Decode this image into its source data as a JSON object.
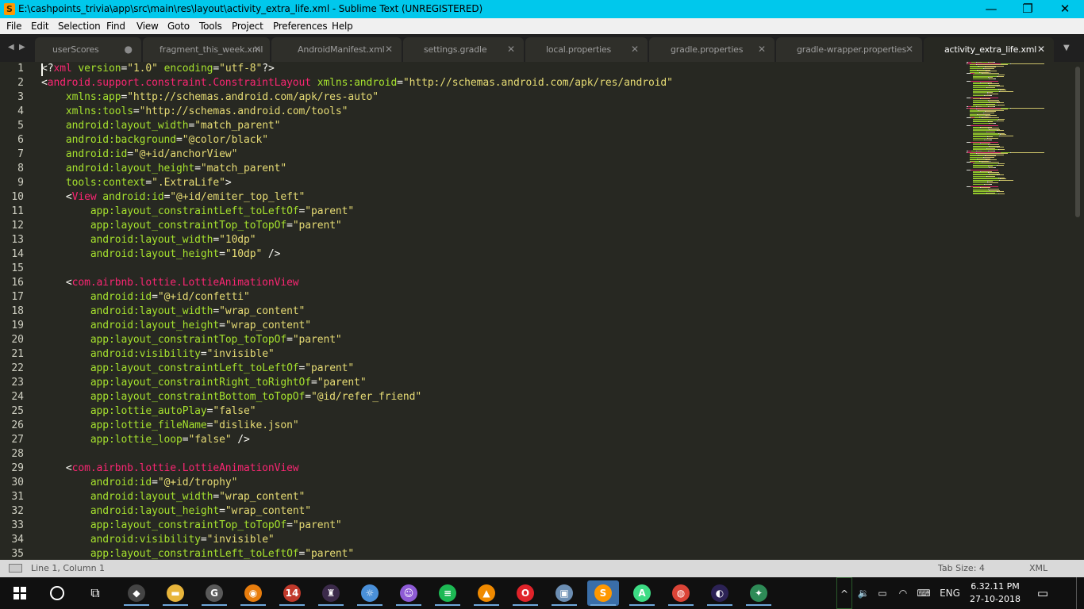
{
  "window": {
    "title": "E:\\cashpoints_trivia\\app\\src\\main\\res\\layout\\activity_extra_life.xml - Sublime Text (UNREGISTERED)",
    "app_icon_letter": "S",
    "controls": {
      "minimize": "—",
      "maximize": "❐",
      "close": "✕"
    },
    "title_bar_color": "#00c8ec"
  },
  "menu": [
    "File",
    "Edit",
    "Selection",
    "Find",
    "View",
    "Goto",
    "Tools",
    "Project",
    "Preferences",
    "Help"
  ],
  "tabs": [
    {
      "label": "userScores",
      "close": "●",
      "active": false
    },
    {
      "label": "fragment_this_week.xml",
      "close": "✕",
      "active": false
    },
    {
      "label": "AndroidManifest.xml",
      "close": "✕",
      "active": false
    },
    {
      "label": "settings.gradle",
      "close": "✕",
      "active": false
    },
    {
      "label": "local.properties",
      "close": "✕",
      "active": false
    },
    {
      "label": "gradle.properties",
      "close": "✕",
      "active": false
    },
    {
      "label": "gradle-wrapper.properties",
      "close": "✕",
      "active": false
    },
    {
      "label": "activity_extra_life.xml",
      "close": "✕",
      "active": true
    }
  ],
  "tab_nav": {
    "left": "◀",
    "right": "▶",
    "menu": "▼"
  },
  "colors": {
    "editor_bg": "#272822",
    "tag": "#f92672",
    "attribute": "#a6e22e",
    "string": "#e6db74",
    "plain": "#f8f8f2"
  },
  "code_lines": [
    [
      [
        "p",
        "<?"
      ],
      [
        "t",
        "xml "
      ],
      [
        "a",
        "version"
      ],
      [
        "p",
        "="
      ],
      [
        "s",
        "\"1.0\" "
      ],
      [
        "a",
        "encoding"
      ],
      [
        "p",
        "="
      ],
      [
        "s",
        "\"utf-8\""
      ],
      [
        "p",
        "?>"
      ]
    ],
    [
      [
        "p",
        "<"
      ],
      [
        "t",
        "android.support.constraint.ConstraintLayout "
      ],
      [
        "a",
        "xmlns:android"
      ],
      [
        "p",
        "="
      ],
      [
        "s",
        "\"http://schemas.android.com/apk/res/android\""
      ]
    ],
    [
      [
        "p",
        "    "
      ],
      [
        "a",
        "xmlns:app"
      ],
      [
        "p",
        "="
      ],
      [
        "s",
        "\"http://schemas.android.com/apk/res-auto\""
      ]
    ],
    [
      [
        "p",
        "    "
      ],
      [
        "a",
        "xmlns:tools"
      ],
      [
        "p",
        "="
      ],
      [
        "s",
        "\"http://schemas.android.com/tools\""
      ]
    ],
    [
      [
        "p",
        "    "
      ],
      [
        "a",
        "android:layout_width"
      ],
      [
        "p",
        "="
      ],
      [
        "s",
        "\"match_parent\""
      ]
    ],
    [
      [
        "p",
        "    "
      ],
      [
        "a",
        "android:background"
      ],
      [
        "p",
        "="
      ],
      [
        "s",
        "\"@color/black\""
      ]
    ],
    [
      [
        "p",
        "    "
      ],
      [
        "a",
        "android:id"
      ],
      [
        "p",
        "="
      ],
      [
        "s",
        "\"@+id/anchorView\""
      ]
    ],
    [
      [
        "p",
        "    "
      ],
      [
        "a",
        "android:layout_height"
      ],
      [
        "p",
        "="
      ],
      [
        "s",
        "\"match_parent\""
      ]
    ],
    [
      [
        "p",
        "    "
      ],
      [
        "a",
        "tools:context"
      ],
      [
        "p",
        "="
      ],
      [
        "s",
        "\".ExtraLife\""
      ],
      [
        "p",
        ">"
      ]
    ],
    [
      [
        "p",
        "    <"
      ],
      [
        "t",
        "View "
      ],
      [
        "a",
        "android:id"
      ],
      [
        "p",
        "="
      ],
      [
        "s",
        "\"@+id/emiter_top_left\""
      ]
    ],
    [
      [
        "p",
        "        "
      ],
      [
        "a",
        "app:layout_constraintLeft_toLeftOf"
      ],
      [
        "p",
        "="
      ],
      [
        "s",
        "\"parent\""
      ]
    ],
    [
      [
        "p",
        "        "
      ],
      [
        "a",
        "app:layout_constraintTop_toTopOf"
      ],
      [
        "p",
        "="
      ],
      [
        "s",
        "\"parent\""
      ]
    ],
    [
      [
        "p",
        "        "
      ],
      [
        "a",
        "android:layout_width"
      ],
      [
        "p",
        "="
      ],
      [
        "s",
        "\"10dp\""
      ]
    ],
    [
      [
        "p",
        "        "
      ],
      [
        "a",
        "android:layout_height"
      ],
      [
        "p",
        "="
      ],
      [
        "s",
        "\"10dp\""
      ],
      [
        "p",
        " />"
      ]
    ],
    [
      [
        "p",
        ""
      ]
    ],
    [
      [
        "p",
        "    <"
      ],
      [
        "t",
        "com.airbnb.lottie.LottieAnimationView"
      ]
    ],
    [
      [
        "p",
        "        "
      ],
      [
        "a",
        "android:id"
      ],
      [
        "p",
        "="
      ],
      [
        "s",
        "\"@+id/confetti\""
      ]
    ],
    [
      [
        "p",
        "        "
      ],
      [
        "a",
        "android:layout_width"
      ],
      [
        "p",
        "="
      ],
      [
        "s",
        "\"wrap_content\""
      ]
    ],
    [
      [
        "p",
        "        "
      ],
      [
        "a",
        "android:layout_height"
      ],
      [
        "p",
        "="
      ],
      [
        "s",
        "\"wrap_content\""
      ]
    ],
    [
      [
        "p",
        "        "
      ],
      [
        "a",
        "app:layout_constraintTop_toTopOf"
      ],
      [
        "p",
        "="
      ],
      [
        "s",
        "\"parent\""
      ]
    ],
    [
      [
        "p",
        "        "
      ],
      [
        "a",
        "android:visibility"
      ],
      [
        "p",
        "="
      ],
      [
        "s",
        "\"invisible\""
      ]
    ],
    [
      [
        "p",
        "        "
      ],
      [
        "a",
        "app:layout_constraintLeft_toLeftOf"
      ],
      [
        "p",
        "="
      ],
      [
        "s",
        "\"parent\""
      ]
    ],
    [
      [
        "p",
        "        "
      ],
      [
        "a",
        "app:layout_constraintRight_toRightOf"
      ],
      [
        "p",
        "="
      ],
      [
        "s",
        "\"parent\""
      ]
    ],
    [
      [
        "p",
        "        "
      ],
      [
        "a",
        "app:layout_constraintBottom_toTopOf"
      ],
      [
        "p",
        "="
      ],
      [
        "s",
        "\"@id/refer_friend\""
      ]
    ],
    [
      [
        "p",
        "        "
      ],
      [
        "a",
        "app:lottie_autoPlay"
      ],
      [
        "p",
        "="
      ],
      [
        "s",
        "\"false\""
      ]
    ],
    [
      [
        "p",
        "        "
      ],
      [
        "a",
        "app:lottie_fileName"
      ],
      [
        "p",
        "="
      ],
      [
        "s",
        "\"dislike.json\""
      ]
    ],
    [
      [
        "p",
        "        "
      ],
      [
        "a",
        "app:lottie_loop"
      ],
      [
        "p",
        "="
      ],
      [
        "s",
        "\"false\""
      ],
      [
        "p",
        " />"
      ]
    ],
    [
      [
        "p",
        ""
      ]
    ],
    [
      [
        "p",
        "    <"
      ],
      [
        "t",
        "com.airbnb.lottie.LottieAnimationView"
      ]
    ],
    [
      [
        "p",
        "        "
      ],
      [
        "a",
        "android:id"
      ],
      [
        "p",
        "="
      ],
      [
        "s",
        "\"@+id/trophy\""
      ]
    ],
    [
      [
        "p",
        "        "
      ],
      [
        "a",
        "android:layout_width"
      ],
      [
        "p",
        "="
      ],
      [
        "s",
        "\"wrap_content\""
      ]
    ],
    [
      [
        "p",
        "        "
      ],
      [
        "a",
        "android:layout_height"
      ],
      [
        "p",
        "="
      ],
      [
        "s",
        "\"wrap_content\""
      ]
    ],
    [
      [
        "p",
        "        "
      ],
      [
        "a",
        "app:layout_constraintTop_toTopOf"
      ],
      [
        "p",
        "="
      ],
      [
        "s",
        "\"parent\""
      ]
    ],
    [
      [
        "p",
        "        "
      ],
      [
        "a",
        "android:visibility"
      ],
      [
        "p",
        "="
      ],
      [
        "s",
        "\"invisible\""
      ]
    ],
    [
      [
        "p",
        "        "
      ],
      [
        "a",
        "app:layout_constraintLeft_toLeftOf"
      ],
      [
        "p",
        "="
      ],
      [
        "s",
        "\"parent\""
      ]
    ]
  ],
  "status": {
    "position": "Line 1, Column 1",
    "tab_size": "Tab Size: 4",
    "syntax": "XML"
  },
  "taskbar": {
    "apps": [
      {
        "name": "unity-icon",
        "glyph": "◆",
        "color": "#444444"
      },
      {
        "name": "file-explorer-icon",
        "glyph": "▬",
        "color": "#e8b53b"
      },
      {
        "name": "github-desktop-icon",
        "glyph": "G",
        "color": "#5a5a5a"
      },
      {
        "name": "blender-icon",
        "glyph": "◉",
        "color": "#e87d0d"
      },
      {
        "name": "photos-badge-icon",
        "glyph": "14",
        "color": "#c0392b"
      },
      {
        "name": "game-character-icon",
        "glyph": "♜",
        "color": "#3b2a4a"
      },
      {
        "name": "weather-globe-icon",
        "glyph": "☼",
        "color": "#4a90d9"
      },
      {
        "name": "cat-app-icon",
        "glyph": "☺",
        "color": "#8e5bd6"
      },
      {
        "name": "spotify-icon",
        "glyph": "≡",
        "color": "#1db954"
      },
      {
        "name": "vlc-icon",
        "glyph": "▲",
        "color": "#f08a00"
      },
      {
        "name": "opera-icon",
        "glyph": "O",
        "color": "#e0232a"
      },
      {
        "name": "folder-app-icon",
        "glyph": "▣",
        "color": "#6c8eb3"
      },
      {
        "name": "sublime-text-icon",
        "glyph": "S",
        "color": "#ff9800"
      },
      {
        "name": "android-studio-icon",
        "glyph": "A",
        "color": "#3ddc84"
      },
      {
        "name": "chrome-icon",
        "glyph": "◍",
        "color": "#db4437"
      },
      {
        "name": "eclipse-icon",
        "glyph": "◐",
        "color": "#2c2255"
      },
      {
        "name": "network-globe-icon",
        "glyph": "✦",
        "color": "#2e8b57"
      }
    ],
    "active_app": "sublime-text-icon",
    "tray": {
      "lang": "ENG",
      "time": "6.32.11 PM",
      "date": "27-10-2018"
    }
  }
}
